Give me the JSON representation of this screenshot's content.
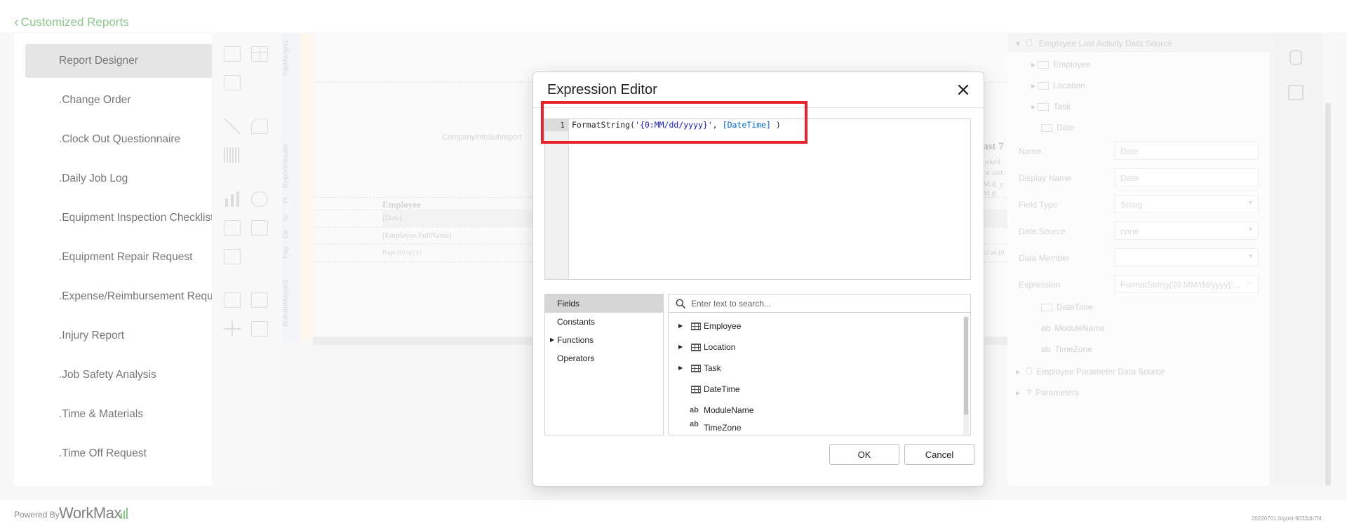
{
  "header": {
    "back_label": "Customized Reports"
  },
  "nav": {
    "items": [
      {
        "label": "Report Designer",
        "active": true
      },
      {
        "label": ".Change Order"
      },
      {
        "label": ".Clock Out Questionnaire"
      },
      {
        "label": ".Daily Job Log"
      },
      {
        "label": ".Equipment Inspection Checklist"
      },
      {
        "label": ".Equipment Repair Request"
      },
      {
        "label": ".Expense/Reimbursement Request"
      },
      {
        "label": ".Injury Report"
      },
      {
        "label": ".Job Safety Analysis"
      },
      {
        "label": ".Time & Materials"
      },
      {
        "label": ".Time Off Request"
      }
    ]
  },
  "designer": {
    "bands": [
      "TopMargin1",
      "ReportHeader",
      "Pi",
      "Gr",
      "De",
      "Pag",
      "BottomMargin1"
    ],
    "subreport_label": "CompanyInfoSubreport",
    "group_label": "Employee",
    "date_field": "[Date]",
    "fullname_field": "[Employee.FullName]",
    "page_info": "Page {0} of {1}",
    "right_fragments": [
      "ast 7",
      "orked",
      "he last",
      "M d, y",
      "M d",
      "ed on {0"
    ]
  },
  "properties": {
    "tree": {
      "datasource": "Employee Last Activity Data Source",
      "children": [
        "Employee",
        "Location",
        "Task",
        "Date"
      ],
      "sub_children": [
        "DateTime",
        "ModuleName",
        "TimeZone"
      ],
      "other_datasource": "Employee Parameter Data Source",
      "parameters": "Parameters"
    },
    "fields": [
      {
        "label": "Name",
        "value": "Date"
      },
      {
        "label": "Display Name",
        "value": "Date"
      },
      {
        "label": "Field Type",
        "value": "String",
        "dropdown": true
      },
      {
        "label": "Data Source",
        "value": "none",
        "dropdown": true
      },
      {
        "label": "Data Member",
        "value": "",
        "dropdown": true
      },
      {
        "label": "Expression",
        "value": "FormatString('{0:MM/dd/yyyy}'..."
      }
    ]
  },
  "dialog": {
    "title": "Expression Editor",
    "line_number": "1",
    "code": {
      "fn": "FormatString(",
      "str": "'{0:MM/dd/yyyy}'",
      "sep": ", ",
      "field": "[DateTime]",
      "end": " )"
    },
    "categories": [
      {
        "label": "Fields",
        "selected": true
      },
      {
        "label": "Constants"
      },
      {
        "label": "Functions",
        "expandable": true
      },
      {
        "label": "Operators"
      }
    ],
    "search_placeholder": "Enter text to search...",
    "fields": [
      {
        "label": "Employee",
        "kind": "table",
        "expandable": true
      },
      {
        "label": "Location",
        "kind": "table",
        "expandable": true
      },
      {
        "label": "Task",
        "kind": "table",
        "expandable": true
      },
      {
        "label": "DateTime",
        "kind": "table"
      },
      {
        "label": "ModuleName",
        "kind": "text",
        "icon_text": "ab"
      },
      {
        "label": "TimeZone",
        "kind": "text",
        "icon_text": "ab"
      }
    ],
    "ok_label": "OK",
    "cancel_label": "Cancel"
  },
  "footer": {
    "powered_by": "Powered By",
    "brand": "WorkMax",
    "version": "20220701.0/gold-9033db7f4"
  },
  "colors": {
    "accent": "#4aa04a",
    "highlight": "#e8232a",
    "string": "#1a1aa6",
    "field": "#0066cc"
  }
}
